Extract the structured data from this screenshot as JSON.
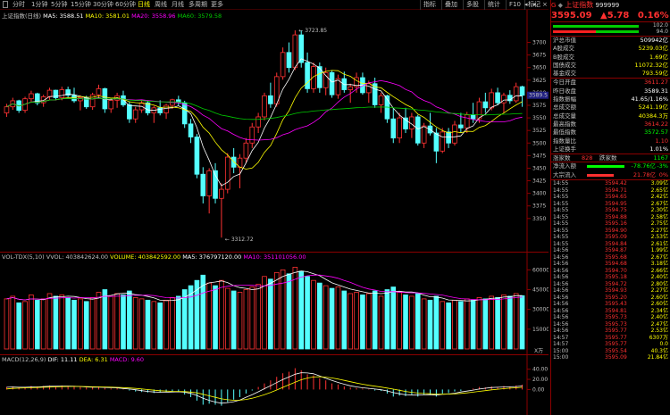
{
  "toolbar": {
    "periods": [
      "分时",
      "1分钟",
      "5分钟",
      "15分钟",
      "30分钟",
      "60分钟",
      "日线",
      "周线",
      "月线",
      "多周期",
      "更多"
    ],
    "right_buttons": [
      "指标",
      "叠加",
      "多股",
      "统计",
      "F10",
      "标记"
    ]
  },
  "main": {
    "title": "上证指数(日线)",
    "ma5": "MA5: 3588.51",
    "ma10": "MA10: 3581.01",
    "ma20": "MA20: 3558.96",
    "ma60": "MA60: 3579.58",
    "high_label": "3723.85",
    "low_label": "3312.72",
    "current_tag": "3589.5",
    "yticks": [
      "3700",
      "3675",
      "3650",
      "3625",
      "3600",
      "3575",
      "3550",
      "3525",
      "3500",
      "3475",
      "3450",
      "3425",
      "3400",
      "3375",
      "3350"
    ]
  },
  "volume": {
    "legend_a": "VOL-TDX(5,10) VVOL: 403842624.00",
    "legend_b": "VOLUME: 403842592.00",
    "legend_c": "MA5: 376797120.00",
    "legend_d": "MA10: 351101056.00",
    "yticks": [
      "60000",
      "45000",
      "30000",
      "15000"
    ],
    "unit": "X万"
  },
  "macd": {
    "legend_a": "MACD(12,26,9)",
    "legend_b": "DIF: 11.11",
    "legend_c": "DEA: 6.31",
    "legend_d": "MACD: 9.60",
    "yticks": [
      "40.00",
      "20.00",
      "0.00"
    ]
  },
  "quote": {
    "g": "G",
    "name": "上证指数",
    "code": "999999",
    "price": "3595.09",
    "change": "▲5.78",
    "pct": "0.16%",
    "bar_up_val": "102.0",
    "bar_dn_val": "94.0",
    "rows1": [
      {
        "k": "沪总市值",
        "v": "509942亿",
        "c": "#ffffff"
      },
      {
        "k": "A股成交",
        "v": "5239.03亿",
        "c": "#ffff00"
      },
      {
        "k": "B股成交",
        "v": "1.69亿",
        "c": "#ffff00"
      },
      {
        "k": "国债成交",
        "v": "11072.32亿",
        "c": "#ffff00"
      },
      {
        "k": "基金成交",
        "v": "793.59亿",
        "c": "#ffff00"
      }
    ],
    "rows2": [
      {
        "k": "今日开盘",
        "v": "3611.27",
        "c": "#ff3030"
      },
      {
        "k": "昨日收盘",
        "v": "3589.31",
        "c": "#ffffff"
      },
      {
        "k": "指数振幅",
        "v": "41.65/1.16%",
        "c": "#ffffff"
      },
      {
        "k": "总成交额",
        "v": "5241.19亿",
        "c": "#ffff00"
      },
      {
        "k": "总成交量",
        "v": "40384.3万",
        "c": "#ffff00"
      },
      {
        "k": "最高指数",
        "v": "3614.22",
        "c": "#ff3030"
      },
      {
        "k": "最低指数",
        "v": "3572.57",
        "c": "#00ff00"
      },
      {
        "k": "指数量比",
        "v": "1.10",
        "c": "#ff3030"
      },
      {
        "k": "上证换手",
        "v": "1.01%",
        "c": "#ffffff"
      }
    ],
    "updown": {
      "k1": "涨家数",
      "v1": "828",
      "k2": "跌家数",
      "v2": "1167"
    },
    "flows": [
      {
        "k": "净流入额",
        "v": "-78.76亿",
        "p": "-3%",
        "c": "#00ff00"
      },
      {
        "k": "大宗流入",
        "v": "21.78亿",
        "p": "0%",
        "c": "#ff3030"
      }
    ],
    "ticks": [
      {
        "t": "14:55",
        "p": "3594.42",
        "q": "3.09亿"
      },
      {
        "t": "14:55",
        "p": "3594.71",
        "q": "2.65亿"
      },
      {
        "t": "14:55",
        "p": "3594.65",
        "q": "2.42亿"
      },
      {
        "t": "14:55",
        "p": "3594.95",
        "q": "2.67亿"
      },
      {
        "t": "14:55",
        "p": "3594.75",
        "q": "2.30亿"
      },
      {
        "t": "14:55",
        "p": "3594.88",
        "q": "2.58亿"
      },
      {
        "t": "14:55",
        "p": "3595.16",
        "q": "2.75亿"
      },
      {
        "t": "14:55",
        "p": "3594.90",
        "q": "2.27亿"
      },
      {
        "t": "14:55",
        "p": "3595.09",
        "q": "2.53亿"
      },
      {
        "t": "14:55",
        "p": "3594.84",
        "q": "2.61亿"
      },
      {
        "t": "14:56",
        "p": "3594.87",
        "q": "1.99亿"
      },
      {
        "t": "14:56",
        "p": "3595.68",
        "q": "2.67亿"
      },
      {
        "t": "14:56",
        "p": "3594.68",
        "q": "3.18亿"
      },
      {
        "t": "14:56",
        "p": "3594.70",
        "q": "2.66亿"
      },
      {
        "t": "14:56",
        "p": "3595.18",
        "q": "2.40亿"
      },
      {
        "t": "14:56",
        "p": "3594.72",
        "q": "2.80亿"
      },
      {
        "t": "14:56",
        "p": "3594.93",
        "q": "2.27亿"
      },
      {
        "t": "14:56",
        "p": "3595.20",
        "q": "2.60亿"
      },
      {
        "t": "14:56",
        "p": "3595.43",
        "q": "2.60亿"
      },
      {
        "t": "14:56",
        "p": "3594.81",
        "q": "2.34亿"
      },
      {
        "t": "14:56",
        "p": "3595.73",
        "q": "2.40亿"
      },
      {
        "t": "14:56",
        "p": "3595.73",
        "q": "2.47亿"
      },
      {
        "t": "14:56",
        "p": "3595.77",
        "q": "2.53亿"
      },
      {
        "t": "14:57",
        "p": "3595.77",
        "q": "6307万"
      },
      {
        "t": "14:57",
        "p": "3595.77",
        "q": "0.0"
      },
      {
        "t": "15:00",
        "p": "3595.54",
        "q": "40.3亿"
      },
      {
        "t": "15:00",
        "p": "3595.09",
        "q": "21.84亿"
      }
    ]
  },
  "colors": {
    "up": "#ff3232",
    "down": "#54ffff",
    "ma5": "#ffffff",
    "ma10": "#ffff00",
    "ma20": "#ff00ff",
    "ma60": "#00cc00",
    "grid": "#8b0000"
  },
  "chart_data": {
    "type": "candlestick",
    "ylim": [
      3300,
      3740
    ],
    "ohlc": [
      [
        3560,
        3578,
        3552,
        3572
      ],
      [
        3572,
        3590,
        3566,
        3584
      ],
      [
        3584,
        3586,
        3560,
        3565
      ],
      [
        3565,
        3592,
        3560,
        3588
      ],
      [
        3588,
        3604,
        3580,
        3598
      ],
      [
        3598,
        3600,
        3575,
        3580
      ],
      [
        3580,
        3596,
        3572,
        3592
      ],
      [
        3592,
        3610,
        3585,
        3605
      ],
      [
        3605,
        3606,
        3585,
        3590
      ],
      [
        3590,
        3612,
        3585,
        3606
      ],
      [
        3606,
        3612,
        3590,
        3595
      ],
      [
        3595,
        3610,
        3580,
        3584
      ],
      [
        3584,
        3595,
        3565,
        3590
      ],
      [
        3590,
        3594,
        3568,
        3572
      ],
      [
        3572,
        3600,
        3566,
        3596
      ],
      [
        3596,
        3616,
        3590,
        3608
      ],
      [
        3608,
        3610,
        3560,
        3568
      ],
      [
        3568,
        3590,
        3560,
        3585
      ],
      [
        3585,
        3600,
        3570,
        3594
      ],
      [
        3594,
        3604,
        3572,
        3576
      ],
      [
        3576,
        3582,
        3540,
        3548
      ],
      [
        3548,
        3572,
        3540,
        3566
      ],
      [
        3566,
        3586,
        3560,
        3580
      ],
      [
        3580,
        3584,
        3555,
        3560
      ],
      [
        3560,
        3574,
        3540,
        3570
      ],
      [
        3570,
        3585,
        3555,
        3560
      ],
      [
        3560,
        3578,
        3548,
        3575
      ],
      [
        3575,
        3588,
        3568,
        3586
      ],
      [
        3586,
        3594,
        3575,
        3580
      ],
      [
        3580,
        3584,
        3530,
        3538
      ],
      [
        3538,
        3548,
        3500,
        3512
      ],
      [
        3512,
        3518,
        3430,
        3438
      ],
      [
        3438,
        3452,
        3380,
        3395
      ],
      [
        3395,
        3450,
        3360,
        3445
      ],
      [
        3445,
        3460,
        3380,
        3390
      ],
      [
        3390,
        3420,
        3312,
        3408
      ],
      [
        3408,
        3480,
        3400,
        3472
      ],
      [
        3472,
        3490,
        3440,
        3452
      ],
      [
        3452,
        3478,
        3410,
        3470
      ],
      [
        3470,
        3510,
        3460,
        3500
      ],
      [
        3500,
        3540,
        3490,
        3532
      ],
      [
        3532,
        3560,
        3520,
        3552
      ],
      [
        3552,
        3600,
        3545,
        3594
      ],
      [
        3594,
        3620,
        3570,
        3578
      ],
      [
        3578,
        3640,
        3572,
        3632
      ],
      [
        3632,
        3690,
        3626,
        3680
      ],
      [
        3680,
        3700,
        3640,
        3650
      ],
      [
        3650,
        3724,
        3645,
        3715
      ],
      [
        3715,
        3724,
        3650,
        3660
      ],
      [
        3660,
        3680,
        3600,
        3608
      ],
      [
        3608,
        3660,
        3600,
        3652
      ],
      [
        3652,
        3660,
        3600,
        3610
      ],
      [
        3610,
        3650,
        3595,
        3640
      ],
      [
        3640,
        3644,
        3590,
        3596
      ],
      [
        3596,
        3636,
        3588,
        3628
      ],
      [
        3628,
        3642,
        3600,
        3606
      ],
      [
        3606,
        3618,
        3580,
        3612
      ],
      [
        3612,
        3640,
        3600,
        3630
      ],
      [
        3630,
        3640,
        3596,
        3600
      ],
      [
        3600,
        3624,
        3580,
        3618
      ],
      [
        3618,
        3630,
        3570,
        3576
      ],
      [
        3576,
        3600,
        3560,
        3594
      ],
      [
        3594,
        3596,
        3540,
        3548
      ],
      [
        3548,
        3570,
        3500,
        3510
      ],
      [
        3510,
        3560,
        3500,
        3550
      ],
      [
        3550,
        3570,
        3520,
        3528
      ],
      [
        3528,
        3560,
        3510,
        3552
      ],
      [
        3552,
        3556,
        3495,
        3500
      ],
      [
        3500,
        3540,
        3490,
        3534
      ],
      [
        3534,
        3560,
        3515,
        3520
      ],
      [
        3520,
        3530,
        3460,
        3484
      ],
      [
        3484,
        3530,
        3480,
        3522
      ],
      [
        3522,
        3530,
        3490,
        3500
      ],
      [
        3500,
        3544,
        3495,
        3536
      ],
      [
        3536,
        3560,
        3520,
        3530
      ],
      [
        3530,
        3562,
        3520,
        3556
      ],
      [
        3556,
        3580,
        3540,
        3548
      ],
      [
        3548,
        3590,
        3540,
        3582
      ],
      [
        3582,
        3600,
        3560,
        3570
      ],
      [
        3570,
        3608,
        3565,
        3600
      ],
      [
        3600,
        3610,
        3575,
        3580
      ],
      [
        3580,
        3600,
        3560,
        3595
      ],
      [
        3595,
        3605,
        3578,
        3584
      ],
      [
        3584,
        3620,
        3580,
        3612
      ],
      [
        3612,
        3614,
        3572,
        3595
      ]
    ],
    "volume_ylim": [
      0,
      65000
    ],
    "volume": [
      38000,
      40000,
      35000,
      36000,
      41000,
      37000,
      38000,
      42000,
      40000,
      41000,
      39000,
      37000,
      38000,
      36000,
      39000,
      43000,
      45000,
      40000,
      42000,
      41000,
      44000,
      39000,
      38000,
      37000,
      36000,
      35000,
      37000,
      39000,
      40000,
      45000,
      48000,
      52000,
      56000,
      50000,
      48000,
      52000,
      46000,
      44000,
      43000,
      45000,
      47000,
      49000,
      55000,
      53000,
      58000,
      60000,
      57000,
      62000,
      59000,
      55000,
      52000,
      50000,
      48000,
      46000,
      47000,
      44000,
      42000,
      43000,
      41000,
      42000,
      44000,
      40000,
      45000,
      47000,
      43000,
      41000,
      40000,
      42000,
      38000,
      37000,
      40000,
      36000,
      35000,
      37000,
      36000,
      38000,
      37000,
      39000,
      38000,
      40000,
      39000,
      41000,
      40000,
      42000,
      40384
    ],
    "macd_ylim": [
      -45,
      50
    ],
    "macd": [
      5,
      6,
      4,
      5,
      7,
      6,
      7,
      8,
      7,
      8,
      7,
      6,
      5,
      4,
      5,
      6,
      3,
      2,
      3,
      1,
      -2,
      -4,
      -5,
      -6,
      -7,
      -6,
      -5,
      -4,
      -5,
      -10,
      -15,
      -22,
      -30,
      -28,
      -30,
      -32,
      -25,
      -20,
      -15,
      -8,
      -2,
      5,
      12,
      18,
      25,
      32,
      35,
      42,
      38,
      30,
      28,
      22,
      18,
      12,
      10,
      6,
      4,
      3,
      2,
      1,
      -2,
      -3,
      -8,
      -14,
      -12,
      -13,
      -10,
      -14,
      -10,
      -11,
      -14,
      -8,
      -7,
      -4,
      -3,
      0,
      2,
      5,
      4,
      6,
      5,
      7,
      6,
      8,
      9.6
    ]
  }
}
